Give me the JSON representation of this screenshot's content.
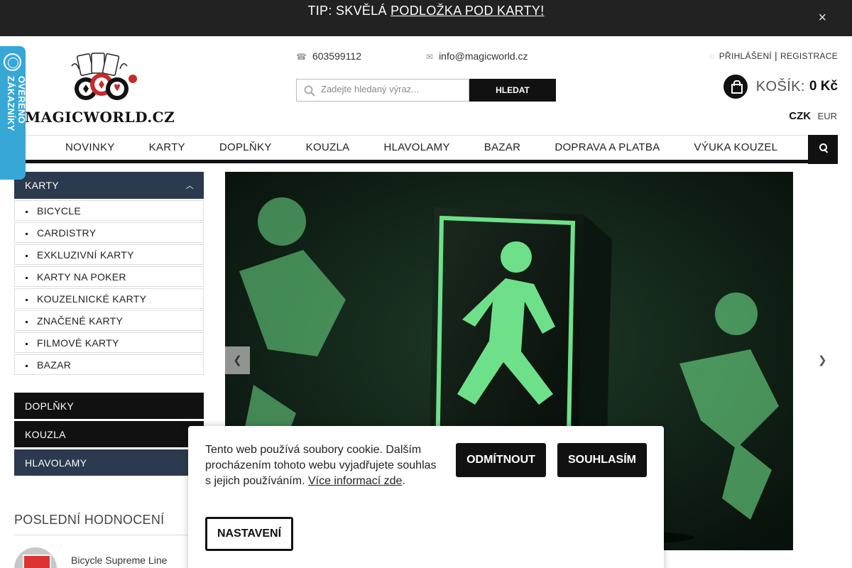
{
  "promo": {
    "prefix": "TIP: SKVĚLÁ ",
    "link": "PODLOŽKA POD KARTY!",
    "close_label": "×"
  },
  "verified_tab": {
    "label": "OVĚŘENO ZÁKAZNÍKY"
  },
  "logo": {
    "text": "MAGICWORLD.CZ"
  },
  "contact": {
    "phone": "603599112",
    "email": "info@magicworld.cz"
  },
  "account": {
    "login": "PŘIHLÁŠENÍ",
    "separator": "|",
    "register": "REGISTRACE"
  },
  "search": {
    "placeholder": "Zadejte hledaný výraz...",
    "button": "HLEDAT"
  },
  "cart": {
    "label": "KOŠÍK:",
    "amount": "0 Kč"
  },
  "currency": {
    "selected": "CZK",
    "other": "EUR"
  },
  "nav": {
    "items": [
      "NOVINKY",
      "KARTY",
      "DOPLŇKY",
      "KOUZLA",
      "HLAVOLAMY",
      "BAZAR",
      "DOPRAVA A PLATBA",
      "VÝUKA KOUZEL"
    ]
  },
  "sidebar": {
    "active_category": "KARTY",
    "subcategories": [
      "BICYCLE",
      "CARDISTRY",
      "EXKLUZIVNÍ KARTY",
      "KARTY NA POKER",
      "KOUZELNICKÉ KARTY",
      "ZNAČENÉ KARTY",
      "FILMOVÉ KARTY",
      "BAZAR"
    ],
    "categories": [
      "DOPLŇKY",
      "KOUZLA",
      "HLAVOLAMY"
    ]
  },
  "reviews": {
    "title": "POSLEDNÍ HODNOCENÍ",
    "first_product": "Bicycle Supreme Line"
  },
  "cookie": {
    "text": "Tento web používá soubory cookie. Dalším procházením tohoto webu vyjadřujete souhlas s jejich používáním. ",
    "more_link": "Více informací zde",
    "after_link": ".",
    "reject": "ODMÍTNOUT",
    "accept": "SOUHLASÍM",
    "settings": "NASTAVENÍ"
  },
  "colors": {
    "topbar": "#222222",
    "verified_tab": "#37a7d6",
    "sidebar_active": "#2b3a4e",
    "hero_green": "#6fe08a"
  },
  "icons": {
    "phone": "phone-icon",
    "email": "envelope-icon",
    "login": "user-icon",
    "cart": "shopping-bag-icon",
    "search": "search-icon",
    "home": "home-icon"
  }
}
